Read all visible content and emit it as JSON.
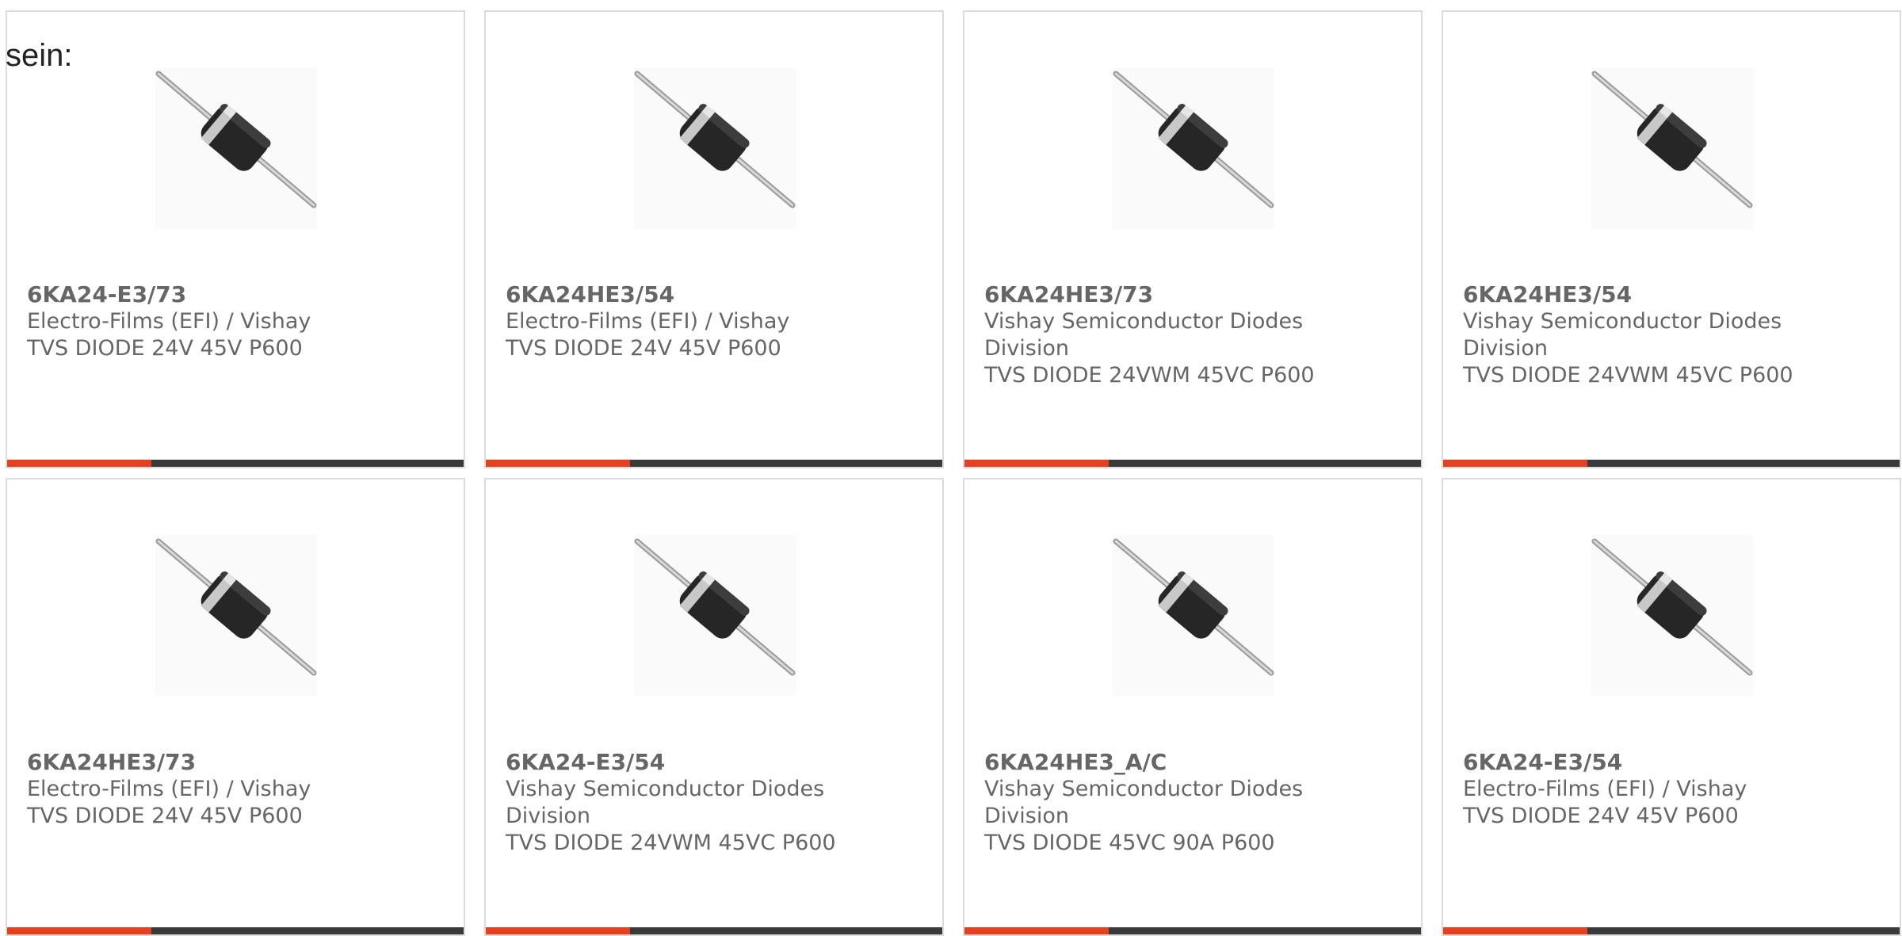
{
  "intro_text": "sein:",
  "colors": {
    "accent": "#e8401c",
    "bar": "#3a3a3a",
    "border": "#dcdcdc",
    "text": "#666666"
  },
  "products": [
    {
      "part_number": "6KA24-E3/73",
      "manufacturer": "Electro-Films (EFI) / Vishay",
      "description": "TVS DIODE 24V 45V P600",
      "image": "axial-diode-icon"
    },
    {
      "part_number": "6KA24HE3/54",
      "manufacturer": "Electro-Films (EFI) / Vishay",
      "description": "TVS DIODE 24V 45V P600",
      "image": "axial-diode-icon"
    },
    {
      "part_number": "6KA24HE3/73",
      "manufacturer": "Vishay Semiconductor Diodes Division",
      "description": "TVS DIODE 24VWM 45VC P600",
      "image": "axial-diode-icon"
    },
    {
      "part_number": "6KA24HE3/54",
      "manufacturer": "Vishay Semiconductor Diodes Division",
      "description": "TVS DIODE 24VWM 45VC P600",
      "image": "axial-diode-icon"
    },
    {
      "part_number": "6KA24HE3/73",
      "manufacturer": "Electro-Films (EFI) / Vishay",
      "description": "TVS DIODE 24V 45V P600",
      "image": "axial-diode-icon"
    },
    {
      "part_number": "6KA24-E3/54",
      "manufacturer": "Vishay Semiconductor Diodes Division",
      "description": "TVS DIODE 24VWM 45VC P600",
      "image": "axial-diode-icon"
    },
    {
      "part_number": "6KA24HE3_A/C",
      "manufacturer": "Vishay Semiconductor Diodes Division",
      "description": "TVS DIODE 45VC 90A P600",
      "image": "axial-diode-icon"
    },
    {
      "part_number": "6KA24-E3/54",
      "manufacturer": "Electro-Films (EFI) / Vishay",
      "description": "TVS DIODE 24V 45V P600",
      "image": "axial-diode-icon"
    }
  ]
}
